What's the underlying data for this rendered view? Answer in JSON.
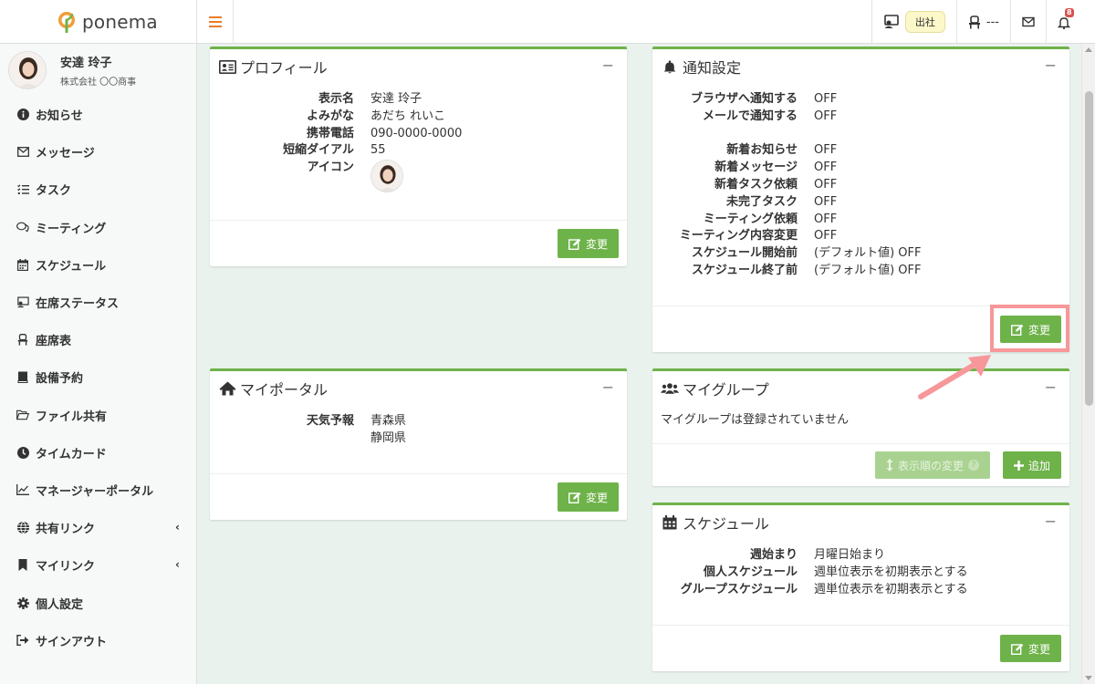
{
  "header": {
    "logo_text": "ponema",
    "status_pill": "出社",
    "seat_text": "---",
    "notification_count": "8"
  },
  "sidebar": {
    "user_name": "安達 玲子",
    "user_company": "株式会社 〇〇商事",
    "items": [
      {
        "label": "お知らせ"
      },
      {
        "label": "メッセージ"
      },
      {
        "label": "タスク"
      },
      {
        "label": "ミーティング"
      },
      {
        "label": "スケジュール"
      },
      {
        "label": "在席ステータス"
      },
      {
        "label": "座席表"
      },
      {
        "label": "設備予約"
      },
      {
        "label": "ファイル共有"
      },
      {
        "label": "タイムカード"
      },
      {
        "label": "マネージャーポータル"
      },
      {
        "label": "共有リンク"
      },
      {
        "label": "マイリンク"
      },
      {
        "label": "個人設定"
      },
      {
        "label": "サインアウト"
      }
    ]
  },
  "profile": {
    "title": "プロフィール",
    "rows": [
      {
        "key": "表示名",
        "value": "安達 玲子"
      },
      {
        "key": "よみがな",
        "value": "あだち れいこ"
      },
      {
        "key": "携帯電話",
        "value": "090-0000-0000"
      },
      {
        "key": "短縮ダイアル",
        "value": "55"
      },
      {
        "key": "アイコン",
        "value": ""
      }
    ],
    "edit_label": "変更"
  },
  "notification": {
    "title": "通知設定",
    "rows_top": [
      {
        "key": "ブラウザへ通知する",
        "value": "OFF"
      },
      {
        "key": "メールで通知する",
        "value": "OFF"
      }
    ],
    "rows_bottom": [
      {
        "key": "新着お知らせ",
        "value": "OFF"
      },
      {
        "key": "新着メッセージ",
        "value": "OFF"
      },
      {
        "key": "新着タスク依頼",
        "value": "OFF"
      },
      {
        "key": "未完了タスク",
        "value": "OFF"
      },
      {
        "key": "ミーティング依頼",
        "value": "OFF"
      },
      {
        "key": "ミーティング内容変更",
        "value": "OFF"
      },
      {
        "key": "スケジュール開始前",
        "value": "(デフォルト値) OFF"
      },
      {
        "key": "スケジュール終了前",
        "value": "(デフォルト値) OFF"
      }
    ],
    "edit_label": "変更"
  },
  "portal": {
    "title": "マイポータル",
    "weather_key": "天気予報",
    "weather_values": [
      "青森県",
      "静岡県"
    ],
    "edit_label": "変更"
  },
  "group": {
    "title": "マイグループ",
    "empty_text": "マイグループは登録されていません",
    "reorder_label": "表示順の変更",
    "add_label": "追加"
  },
  "schedule": {
    "title": "スケジュール",
    "rows": [
      {
        "key": "週始まり",
        "value": "月曜日始まり"
      },
      {
        "key": "個人スケジュール",
        "value": "週単位表示を初期表示とする"
      },
      {
        "key": "グループスケジュール",
        "value": "週単位表示を初期表示とする"
      }
    ],
    "edit_label": "変更"
  },
  "colors": {
    "accent": "#6eb24a",
    "highlight": "#f7979a",
    "menu_toggle": "#e87d2b"
  }
}
